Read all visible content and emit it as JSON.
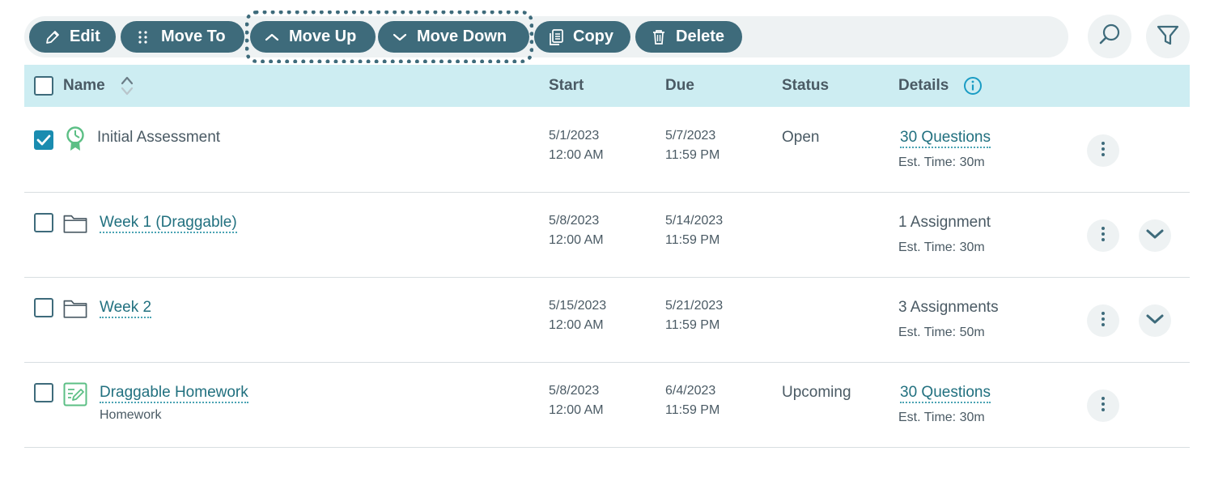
{
  "toolbar": {
    "edit_label": "Edit",
    "move_to_label": "Move To",
    "move_up_label": "Move Up",
    "move_down_label": "Move Down",
    "copy_label": "Copy",
    "delete_label": "Delete"
  },
  "header": {
    "name": "Name",
    "start": "Start",
    "due": "Due",
    "status": "Status",
    "details": "Details"
  },
  "rows": [
    {
      "name": "Initial Assessment",
      "checked": true,
      "icon": "assessment-ribbon-icon",
      "start_date": "5/1/2023",
      "start_time": "12:00 AM",
      "due_date": "5/7/2023",
      "due_time": "11:59 PM",
      "status": "Open",
      "details": "30 Questions",
      "est_time": "Est. Time: 30m"
    },
    {
      "name": "Week 1 (Draggable)",
      "checked": false,
      "icon": "folder-icon",
      "start_date": "5/8/2023",
      "start_time": "12:00 AM",
      "due_date": "5/14/2023",
      "due_time": "11:59 PM",
      "status": "",
      "details": "1 Assignment",
      "est_time": "Est. Time: 30m"
    },
    {
      "name": "Week 2",
      "checked": false,
      "icon": "folder-icon",
      "start_date": "5/15/2023",
      "start_time": "12:00 AM",
      "due_date": "5/21/2023",
      "due_time": "11:59 PM",
      "status": "",
      "details": "3 Assignments",
      "est_time": "Est. Time: 50m"
    },
    {
      "name": "Draggable Homework",
      "subtitle": "Homework",
      "checked": false,
      "icon": "homework-icon",
      "start_date": "5/8/2023",
      "start_time": "12:00 AM",
      "due_date": "6/4/2023",
      "due_time": "11:59 PM",
      "status": "Upcoming",
      "details": "30 Questions",
      "est_time": "Est. Time: 30m"
    }
  ],
  "colors": {
    "accent": "#3e6b7b",
    "header_bg": "#cdedf2",
    "link": "#21707f",
    "check": "#1a8cb0",
    "assessment_green": "#5cbf85"
  }
}
